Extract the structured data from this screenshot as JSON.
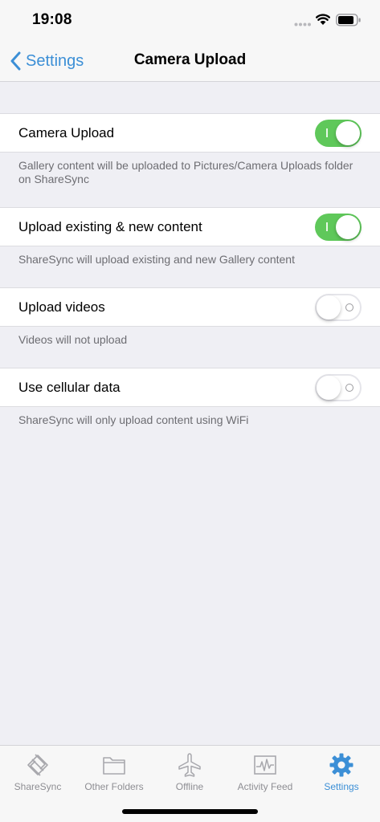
{
  "status": {
    "time": "19:08"
  },
  "nav": {
    "back_label": "Settings",
    "title": "Camera Upload"
  },
  "settings": [
    {
      "label": "Camera Upload",
      "on": true,
      "footnote": "Gallery content will be uploaded to Pictures/Camera Uploads folder on ShareSync"
    },
    {
      "label": "Upload existing & new content",
      "on": true,
      "footnote": "ShareSync will upload existing and new Gallery content"
    },
    {
      "label": "Upload videos",
      "on": false,
      "footnote": "Videos will not upload"
    },
    {
      "label": "Use cellular data",
      "on": false,
      "footnote": "ShareSync will only upload content using WiFi"
    }
  ],
  "tabs": [
    {
      "label": "ShareSync",
      "icon": "sharesync-icon",
      "active": false
    },
    {
      "label": "Other Folders",
      "icon": "folder-icon",
      "active": false
    },
    {
      "label": "Offline",
      "icon": "airplane-icon",
      "active": false
    },
    {
      "label": "Activity Feed",
      "icon": "activity-icon",
      "active": false
    },
    {
      "label": "Settings",
      "icon": "gear-icon",
      "active": true
    }
  ],
  "colors": {
    "accent": "#3c8fd6",
    "toggle_on": "#5fc85a",
    "background": "#efeff4"
  }
}
